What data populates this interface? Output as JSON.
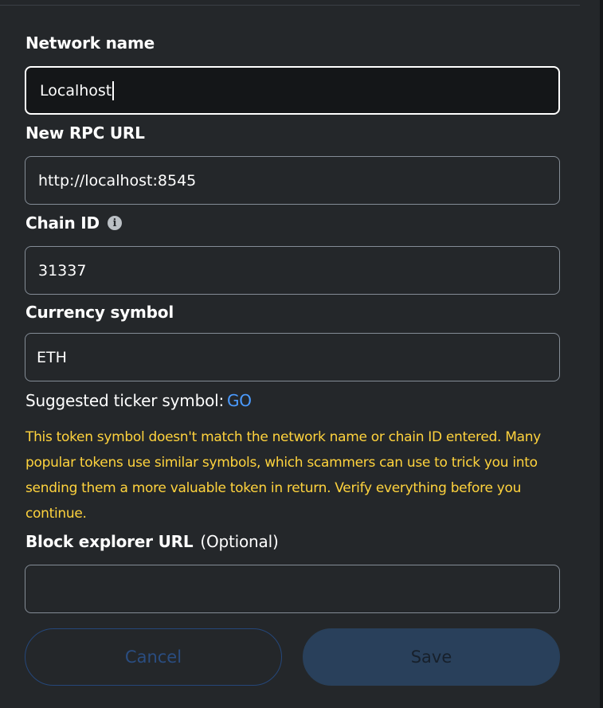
{
  "form": {
    "network_name": {
      "label": "Network name",
      "value": "Localhost"
    },
    "rpc_url": {
      "label": "New RPC URL",
      "value": "http://localhost:8545"
    },
    "chain_id": {
      "label": "Chain ID",
      "info_glyph": "i",
      "value": "31337"
    },
    "currency_symbol": {
      "label": "Currency symbol",
      "value": "ETH"
    },
    "suggested_ticker": {
      "prefix": "Suggested ticker symbol:",
      "value": "GO"
    },
    "warning_text": "This token symbol doesn't match the network name or chain ID entered. Many popular tokens use similar symbols, which scammers can use to trick you into sending them a more valuable token in return. Verify everything before you continue.",
    "block_explorer": {
      "label": "Block explorer URL",
      "optional_tag": "(Optional)",
      "value": ""
    }
  },
  "actions": {
    "cancel_label": "Cancel",
    "save_label": "Save"
  },
  "colors": {
    "background": "#24272a",
    "focused_input_bg": "#141618",
    "input_border": "#848c96",
    "link": "#4b9bff",
    "warning": "#ffd33d",
    "cancel_border": "#25477a",
    "save_disabled_bg": "#29405b"
  }
}
